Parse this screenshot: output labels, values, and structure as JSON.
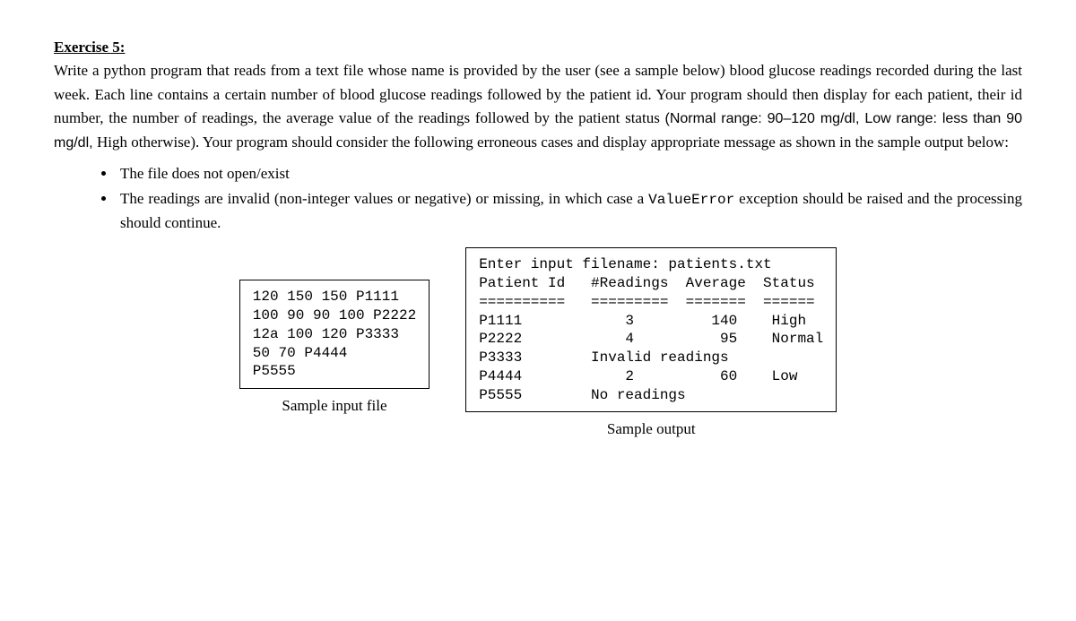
{
  "title_label": "Exercise 5:",
  "para1": "Write a python program that reads from a text file whose name is provided by the user (see a sample below) blood glucose readings recorded during the last week. Each line contains a certain number of blood glucose readings followed by the patient id. Your program should then display for each patient, their id number, the number of readings, the average value of the readings followed by the patient status ",
  "para1_sans1": "(Normal range: 90–120 mg/dl, Low range: less than 90 mg/dl, ",
  "para1_mid": "High otherwise). Your program should consider the following erroneous cases and display appropriate message as shown in the sample output below:",
  "bullets": {
    "b1": "The file does not open/exist",
    "b2_a": "The readings are invalid (non-integer values or negative) or missing, in which case a ",
    "b2_code": "ValueError",
    "b2_b": " exception should be raised and the processing should continue."
  },
  "sample_input": {
    "lines": "120 150 150 P1111\n100 90 90 100 P2222\n12a 100 120 P3333\n50 70 P4444\nP5555",
    "caption": "Sample input file"
  },
  "sample_output": {
    "lines": "Enter input filename: patients.txt\nPatient Id   #Readings  Average  Status\n==========   =========  =======  ======\nP1111            3         140    High\nP2222            4          95    Normal\nP3333        Invalid readings\nP4444            2          60    Low\nP5555        No readings",
    "caption": "Sample output"
  }
}
